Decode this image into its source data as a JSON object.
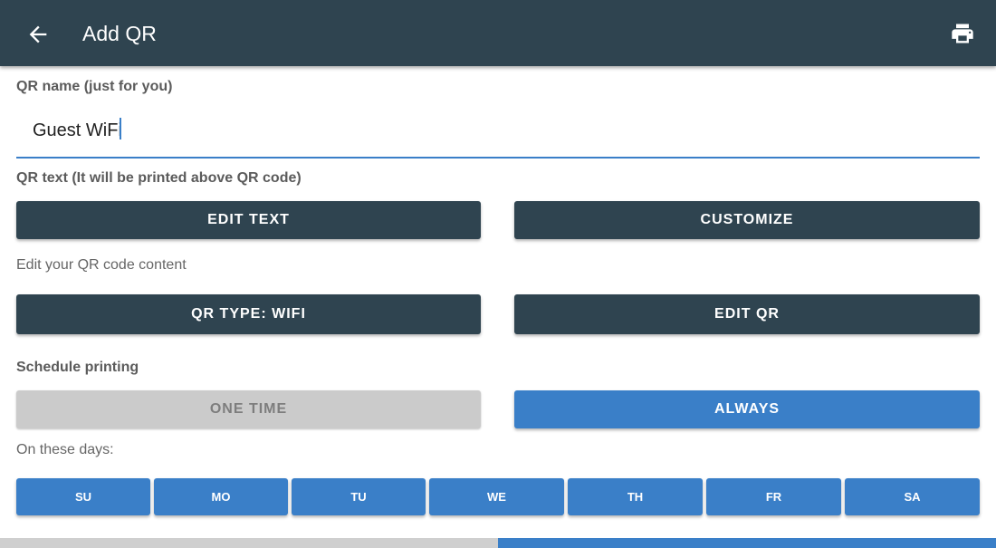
{
  "header": {
    "title": "Add QR",
    "back_icon": "arrow-left-icon",
    "print_icon": "printer-icon",
    "bg_color": "#2f4450"
  },
  "qr_name": {
    "label": "QR name (just for you)",
    "value": "Guest WiFi"
  },
  "qr_text": {
    "label": "QR text (It will be printed above QR code)",
    "edit_text_label": "EDIT TEXT",
    "customize_label": "CUSTOMIZE"
  },
  "qr_content": {
    "label": "Edit your QR code content",
    "type_label": "QR TYPE: WIFI",
    "edit_qr_label": "EDIT QR"
  },
  "schedule": {
    "label": "Schedule printing",
    "one_time_label": "ONE TIME",
    "always_label": "ALWAYS",
    "selected": "ALWAYS",
    "days_label": "On these days:",
    "days": [
      {
        "label": "SU"
      },
      {
        "label": "MO"
      },
      {
        "label": "TU"
      },
      {
        "label": "WE"
      },
      {
        "label": "TH"
      },
      {
        "label": "FR"
      },
      {
        "label": "SA"
      }
    ]
  },
  "colors": {
    "accent": "#3a7fc8",
    "dark": "#2f4450",
    "disabled": "#cbcbcb"
  }
}
